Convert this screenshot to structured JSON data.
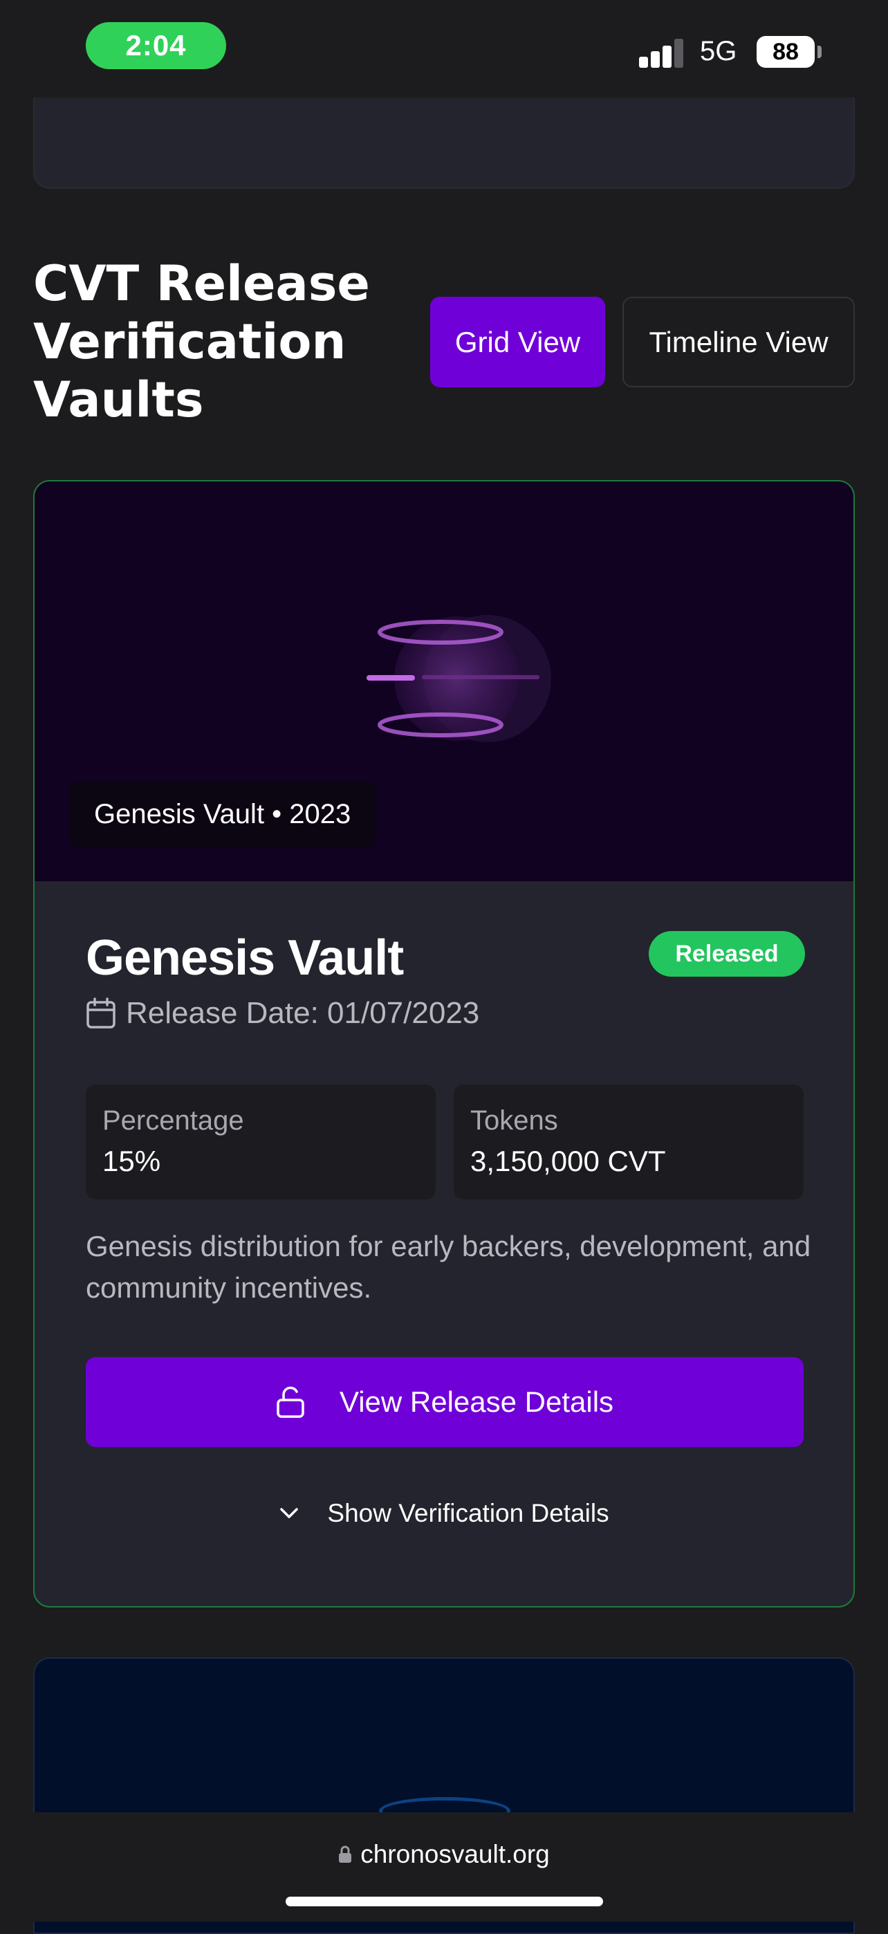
{
  "status_bar": {
    "time": "2:04",
    "network": "5G",
    "battery": "88"
  },
  "section": {
    "title": "CVT Release Verification Vaults",
    "view_toggle": {
      "grid_label": "Grid View",
      "timeline_label": "Timeline View",
      "active": "Grid View"
    }
  },
  "vault": {
    "hero_tag": "Genesis Vault • 2023",
    "name": "Genesis Vault",
    "status": "Released",
    "release_date": "Release Date: 01/07/2023",
    "stats": [
      {
        "label": "Percentage",
        "value": "15%"
      },
      {
        "label": "Tokens",
        "value": "3,150,000 CVT"
      }
    ],
    "description": "Genesis distribution for early backers, development, and community incentives.",
    "cta_label": "View Release Details",
    "verify_label": "Show Verification Details"
  },
  "browser": {
    "url": "chronosvault.org"
  },
  "colors": {
    "accent": "#7000d8",
    "success": "#22c55e",
    "card_border": "#1e7a3c",
    "background": "#1c1c1e"
  },
  "icons": [
    "calendar-icon",
    "unlock-icon",
    "chevron-down-icon",
    "lock-icon",
    "signal-icon",
    "battery-icon",
    "vault-orb-icon"
  ]
}
